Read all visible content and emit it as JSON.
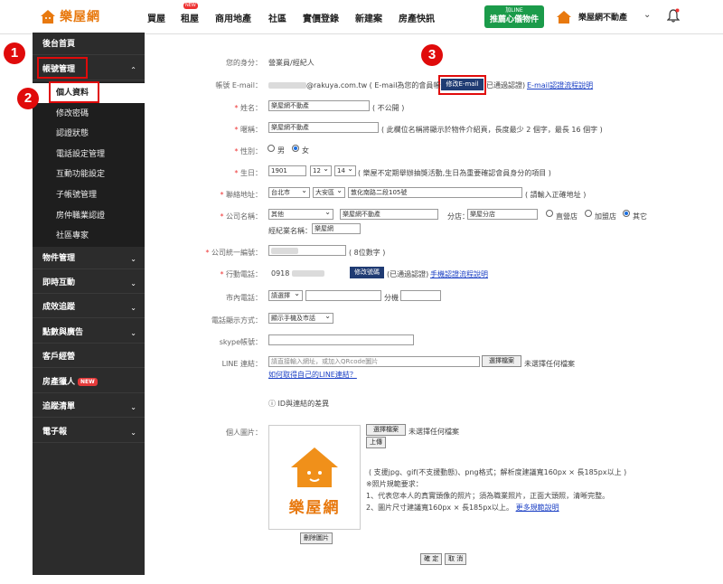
{
  "nav": {
    "logo": "樂屋網",
    "items": [
      "買屋",
      "租屋",
      "商用地產",
      "社區",
      "實價登錄",
      "新建案",
      "房產快訊"
    ],
    "new_badge": "NEW",
    "line_btn_top": "加LINE",
    "line_btn_bottom": "推薦心儀物件",
    "company": "樂屋網不動產"
  },
  "sidebar": {
    "home": "後台首頁",
    "account": "帳號管理",
    "subs": [
      "個人資料",
      "修改密碼",
      "認證狀態",
      "電話設定管理",
      "互動功能設定",
      "子帳號管理",
      "房仲職業認證",
      "社區專家"
    ],
    "groups": [
      "物件管理",
      "即時互動",
      "成效追蹤",
      "點數與廣告",
      "客戶經營",
      "房產獵人",
      "追蹤清單",
      "電子報"
    ],
    "hunter_badge": "NEW"
  },
  "badges": [
    "1",
    "2",
    "3"
  ],
  "form": {
    "identity_label": "您的身分：",
    "identity_value": "營業員/經紀人",
    "email_label": "帳號 E-mail：",
    "email_value": "@rakuya.com.tw ( E-mail為您的會員帳號 )",
    "email_btn": "修改E-mail",
    "email_verified": "已通過認證)",
    "email_link": "E-mail認證流程說明",
    "name_label": "姓名：",
    "name_value": "樂屋網不動產",
    "name_note": "( 不公開 )",
    "nick_label": "暱稱：",
    "nick_value": "樂屋網不動產",
    "nick_note": "( 此欄位名稱將顯示於物件介紹頁，長度最少 2 個字，最長 16 個字 )",
    "gender_label": "性別：",
    "gender_male": "男",
    "gender_female": "女",
    "birth_label": "生日：",
    "birth_year": "1901",
    "birth_month": "12",
    "birth_day": "14",
    "birth_note": "( 樂屋不定期舉辦抽獎活動,生日為重要確認會員身分的項目 )",
    "addr_label": "聯絡地址：",
    "addr_city": "台北市",
    "addr_district": "大安區",
    "addr_street": "敦化南路二段105號",
    "addr_note": "( 請輸入正確地址 )",
    "company_label": "公司名稱：",
    "company_type": "其他",
    "company_name": "樂屋網不動產",
    "branch_label": "分店：",
    "branch_value": "樂屋分店",
    "store_direct": "直營店",
    "store_franchise": "加盟店",
    "store_other": "其它",
    "broker_label": "經紀業名稱：",
    "broker_value": "樂屋網",
    "taxid_label": "公司統一編號：",
    "taxid_note": "( 8位數字 )",
    "mobile_label": "行動電話：",
    "mobile_value": "0918",
    "mobile_btn": "修改號碼",
    "mobile_verified": "(已通過認證)",
    "mobile_link": "手機認證流程說明",
    "tel_label": "市內電話：",
    "tel_select": "請選擇",
    "tel_ext": "分機",
    "display_label": "電話顯示方式：",
    "display_value": "顯示手機及市話",
    "skype_label": "skype帳號：",
    "line_label": "LINE 連結：",
    "line_placeholder": "請直接輸入網址，或加入QRcode圖片",
    "line_file_btn": "選擇檔案",
    "line_file_none": "未選擇任何檔案",
    "line_link": "如何取得自己的LINE連結？",
    "id_note": "ID與連結的差異",
    "photo_label": "個人圖片：",
    "photo_file_btn": "選擇檔案",
    "photo_file_none": "未選擇任何檔案",
    "upload_btn": "上傳",
    "photo_logo_text": "樂屋網",
    "spec1": "( 支援jpg、gif(不支援動態)、png格式；解析度建議寬160px × 長185px以上 )",
    "spec2": "※照片規範要求：",
    "spec3": "1、代表您本人的真實頭像的照片；須為職業照片，正面大頭照，清晰完整。",
    "spec4": "2、圖片尺寸建議寬160px × 長185px以上。",
    "spec_link": "更多規範說明",
    "delete_btn": "刪除圖片",
    "submit_btn": "確 定",
    "cancel_btn": "取 消"
  },
  "colors": {
    "accent": "#e8790f",
    "annot": "#e00b0b",
    "sidebar": "#2c2c2c"
  }
}
